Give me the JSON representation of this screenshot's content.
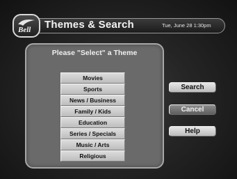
{
  "header": {
    "logo_text": "Bell",
    "title": "Themes & Search",
    "datetime": "Tue, June 28 1:30pm"
  },
  "panel": {
    "prompt": "Please \"Select\" a Theme",
    "themes": [
      "Movies",
      "Sports",
      "News / Business",
      "Family / Kids",
      "Education",
      "Series / Specials",
      "Music / Arts",
      "Religious"
    ]
  },
  "buttons": {
    "search": "Search",
    "cancel": "Cancel",
    "help": "Help"
  }
}
